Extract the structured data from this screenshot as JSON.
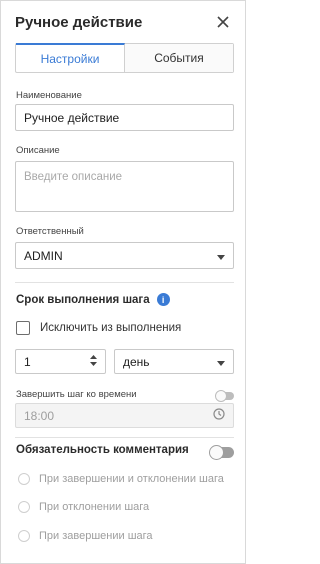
{
  "header": {
    "title": "Ручное действие",
    "close_icon": "close-icon"
  },
  "tabs": [
    {
      "label": "Настройки",
      "active": true
    },
    {
      "label": "События",
      "active": false
    }
  ],
  "name": {
    "label": "Наименование",
    "value": "Ручное действие"
  },
  "description": {
    "label": "Описание",
    "placeholder": "Введите описание"
  },
  "responsible": {
    "label": "Ответственный",
    "value": "ADMIN"
  },
  "deadline": {
    "title": "Срок выполнения шага",
    "exclude_label": "Исключить из выполнения",
    "amount": "1",
    "unit": "день",
    "finish_by_time_label": "Завершить шаг ко времени",
    "time_value": "18:00"
  },
  "comment": {
    "title": "Обязательность комментария",
    "options": [
      "При завершении и отклонении шага",
      "При отклонении шага",
      "При завершении шага"
    ]
  },
  "colors": {
    "accent": "#3a7bd5",
    "border": "#c9c9c9",
    "muted_text": "#9e9e9e"
  }
}
